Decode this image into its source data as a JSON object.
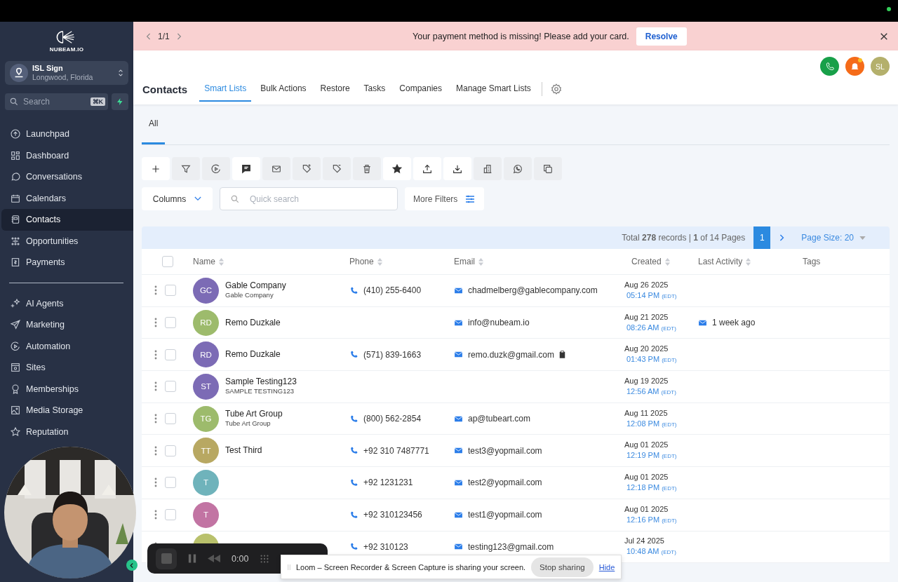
{
  "sidebar": {
    "logo": "NUBEAM.IO",
    "account": {
      "name": "ISL Sign",
      "location": "Longwood, Florida"
    },
    "search": {
      "placeholder": "Search",
      "shortcut": "⌘K"
    },
    "nav": [
      {
        "label": "Launchpad",
        "selected": false
      },
      {
        "label": "Dashboard",
        "selected": false
      },
      {
        "label": "Conversations",
        "selected": false
      },
      {
        "label": "Calendars",
        "selected": false
      },
      {
        "label": "Contacts",
        "selected": true
      },
      {
        "label": "Opportunities",
        "selected": false
      },
      {
        "label": "Payments",
        "selected": false
      }
    ],
    "nav_secondary": [
      {
        "label": "AI Agents",
        "selected": false
      },
      {
        "label": "Marketing",
        "selected": false
      },
      {
        "label": "Automation",
        "selected": false
      },
      {
        "label": "Sites",
        "selected": false
      },
      {
        "label": "Memberships",
        "selected": false
      },
      {
        "label": "Media Storage",
        "selected": false
      },
      {
        "label": "Reputation",
        "selected": false
      }
    ]
  },
  "banner": {
    "pager": "1/1",
    "message": "Your payment method is missing! Please add your card.",
    "action": "Resolve"
  },
  "header": {
    "avatar": "SL"
  },
  "title": "Contacts",
  "tabs": [
    {
      "label": "Smart Lists",
      "selected": true
    },
    {
      "label": "Bulk Actions",
      "selected": false
    },
    {
      "label": "Restore",
      "selected": false
    },
    {
      "label": "Tasks",
      "selected": false
    },
    {
      "label": "Companies",
      "selected": false
    },
    {
      "label": "Manage Smart Lists",
      "selected": false
    }
  ],
  "subtabs": [
    {
      "label": "All",
      "selected": true
    }
  ],
  "toolbar": [
    {
      "disabled": false
    },
    {
      "disabled": true
    },
    {
      "disabled": true
    },
    {
      "disabled": false
    },
    {
      "disabled": true
    },
    {
      "disabled": true
    },
    {
      "disabled": true
    },
    {
      "disabled": true
    },
    {
      "disabled": false
    },
    {
      "disabled": false
    },
    {
      "disabled": false
    },
    {
      "disabled": true
    },
    {
      "disabled": true
    },
    {
      "disabled": true
    }
  ],
  "columns_button": "Columns",
  "quick_search": {
    "placeholder": "Quick search"
  },
  "more_filters": "More Filters",
  "pagination": {
    "summary": "Total **278** records | **1** of 14 Pages",
    "pages": [
      {
        "label": "1",
        "selected": true
      }
    ],
    "page_size": "Page Size: 20"
  },
  "table": {
    "select_all": {
      "checked": false
    },
    "columns": [
      "Name",
      "Phone",
      "Email",
      "Created",
      "Last Activity",
      "Tags"
    ],
    "rows": [
      {
        "initials": "GC",
        "color": "#7c6bb5",
        "checked": false,
        "name": "Gable Company",
        "subtitle": "Gable Company",
        "phone": "(410) 255-6400",
        "email": "chadmelberg@gablecompany.com",
        "copy": false,
        "date": "Aug 26 2025",
        "time": "05:14 PM",
        "tz": "(EDT)"
      },
      {
        "initials": "RD",
        "color": "#9dbb6c",
        "checked": false,
        "name": "Remo Duzkale",
        "email": "info@nubeam.io",
        "copy": false,
        "date": "Aug 21 2025",
        "time": "08:26 AM",
        "tz": "(EDT)",
        "activity": "1 week ago"
      },
      {
        "initials": "RD",
        "color": "#7c6bb5",
        "checked": false,
        "name": "Remo Duzkale",
        "phone": "(571) 839-1663",
        "email": "remo.duzk@gmail.com",
        "copy": true,
        "date": "Aug 20 2025",
        "time": "01:43 PM",
        "tz": "(EDT)"
      },
      {
        "initials": "ST",
        "color": "#7c6bb5",
        "checked": false,
        "name": "Sample Testing123",
        "subtitle": "SAMPLE TESTING123",
        "copy": false,
        "date": "Aug 19 2025",
        "time": "12:56 AM",
        "tz": "(EDT)"
      },
      {
        "initials": "TG",
        "color": "#9dbb6c",
        "checked": false,
        "name": "Tube Art Group",
        "subtitle": "Tube Art Group",
        "phone": "(800) 562-2854",
        "email": "ap@tubeart.com",
        "copy": false,
        "date": "Aug 11 2025",
        "time": "12:08 PM",
        "tz": "(EDT)"
      },
      {
        "initials": "TT",
        "color": "#b8a862",
        "checked": false,
        "name": "Test Third",
        "phone": "+92 310 7487771",
        "email": "test3@yopmail.com",
        "copy": false,
        "date": "Aug 01 2025",
        "time": "12:19 PM",
        "tz": "(EDT)"
      },
      {
        "initials": "T",
        "color": "#6fb3bb",
        "checked": false,
        "phone": "+92 1231231",
        "email": "test2@yopmail.com",
        "copy": false,
        "date": "Aug 01 2025",
        "time": "12:18 PM",
        "tz": "(EDT)"
      },
      {
        "initials": "T",
        "color": "#c274a3",
        "checked": false,
        "phone": "+92 310123456",
        "email": "test1@yopmail.com",
        "copy": false,
        "date": "Aug 01 2025",
        "time": "12:16 PM",
        "tz": "(EDT)"
      },
      {
        "color": "#b9c16c",
        "phone": "+92 310123",
        "email": "testing123@gmail.com",
        "copy": false,
        "date": "Jul 24 2025",
        "time": "10:48 AM",
        "tz": "(EDT)"
      }
    ]
  },
  "recorder": {
    "time": "0:00"
  },
  "share_notice": {
    "message": "Loom – Screen Recorder & Screen Capture is sharing your screen.",
    "stop": "Stop sharing",
    "hide": "Hide"
  }
}
